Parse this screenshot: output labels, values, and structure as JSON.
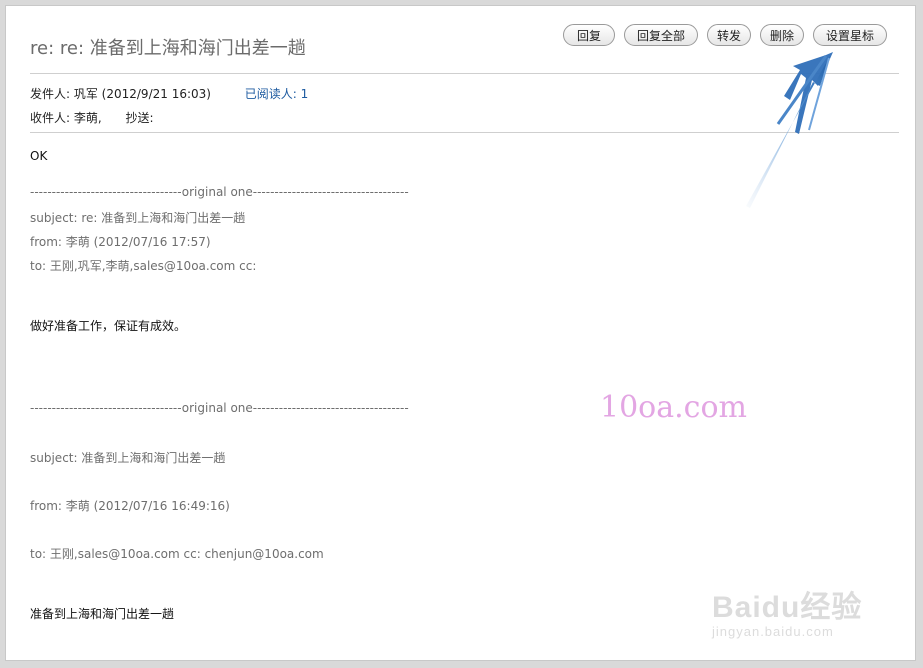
{
  "header": {
    "subject": "re: re: 准备到上海和海门出差一趟"
  },
  "toolbar": {
    "reply": "回复",
    "reply_all": "回复全部",
    "forward": "转发",
    "delete": "删除",
    "set_star": "设置星标"
  },
  "meta": {
    "from": "发件人: 巩军 (2012/9/21 16:03)",
    "readers": "已阅读人: 1",
    "to": "收件人: 李萌,",
    "cc": "抄送:"
  },
  "body": {
    "reply_text": "OK",
    "quote1": {
      "separator": "-----------------------------------original one------------------------------------",
      "subject": "subject: re: 准备到上海和海门出差一趟",
      "from": "from: 李萌 (2012/07/16 17:57)",
      "to": "to: 王刚,巩军,李萌,sales@10oa.com cc:",
      "text": "做好准备工作，保证有成效。"
    },
    "quote2": {
      "separator": "-----------------------------------original one------------------------------------",
      "subject": "subject: 准备到上海和海门出差一趟",
      "from": "from: 李萌 (2012/07/16 16:49:16)",
      "to": "to: 王刚,sales@10oa.com cc: chenjun@10oa.com",
      "text": "准备到上海和海门出差一趟"
    }
  },
  "watermarks": {
    "site": "10oa.com",
    "baidu_logo": "Baidu经验",
    "baidu_url": "jingyan.baidu.com"
  },
  "colors": {
    "arrow": "#2f6fb8",
    "watermark": "#e3a6e3",
    "read_link": "#1c5aa0"
  }
}
